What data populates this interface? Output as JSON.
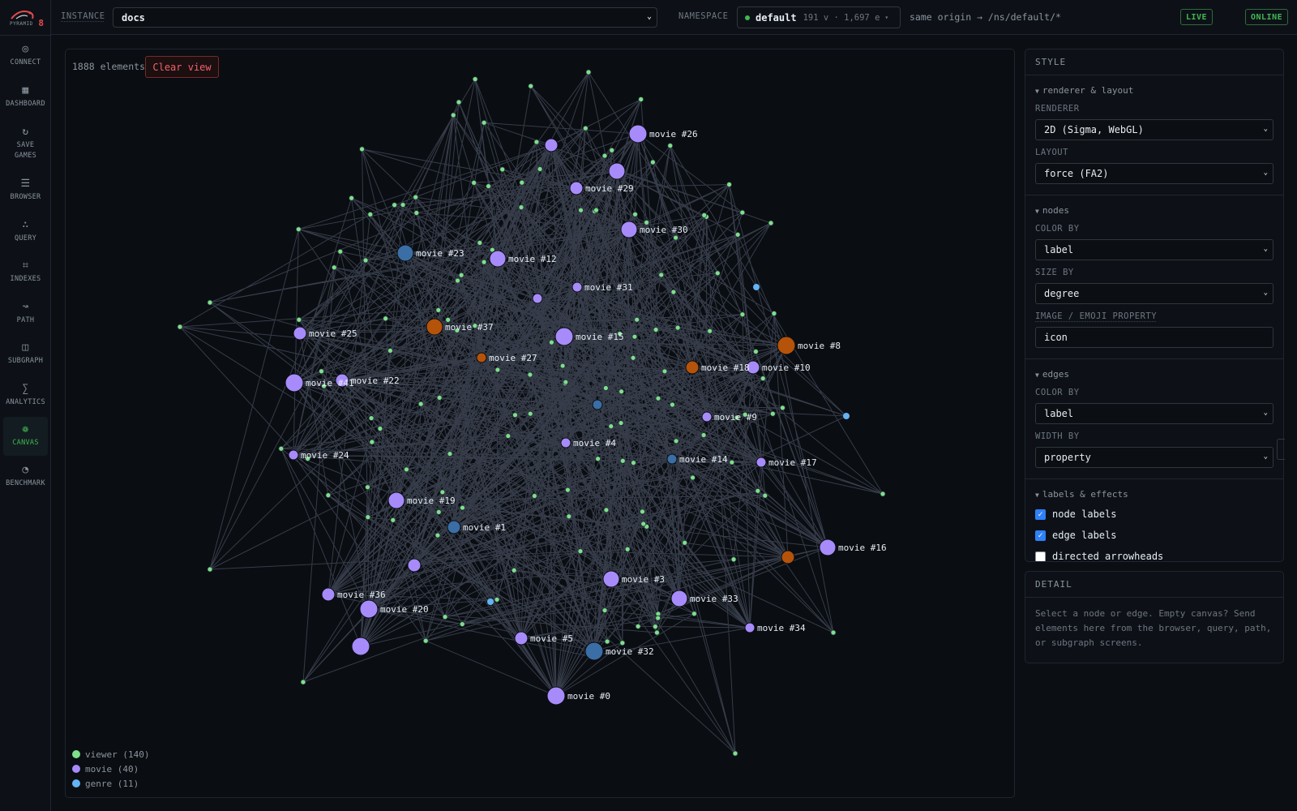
{
  "app": {
    "logo_text": "PYRAMID",
    "logo_mark": "8"
  },
  "sidebar": {
    "items": [
      {
        "label": "CONNECT",
        "icon": "target-icon"
      },
      {
        "label": "DASHBOARD",
        "icon": "grid-icon"
      },
      {
        "label": "SAVE GAMES",
        "icon": "refresh-icon"
      },
      {
        "label": "BROWSER",
        "icon": "list-icon"
      },
      {
        "label": "QUERY",
        "icon": "dots-icon"
      },
      {
        "label": "INDEXES",
        "icon": "frame-icon"
      },
      {
        "label": "PATH",
        "icon": "path-icon"
      },
      {
        "label": "SUBGRAPH",
        "icon": "subgraph-icon"
      },
      {
        "label": "ANALYTICS",
        "icon": "sigma-icon"
      },
      {
        "label": "CANVAS",
        "icon": "canvas-icon",
        "active": true
      },
      {
        "label": "BENCHMARK",
        "icon": "gauge-icon"
      }
    ]
  },
  "topbar": {
    "instance_label": "INSTANCE",
    "instance_value": "docs",
    "namespace_label": "NAMESPACE",
    "namespace_name": "default",
    "namespace_stats": "191 v · 1,697 e",
    "origin": "same origin → /ns/default/*",
    "live_badge": "LIVE",
    "online_badge": "ONLINE"
  },
  "canvas": {
    "element_count": "1888 elements",
    "clear_label": "Clear view",
    "legend": [
      {
        "label": "viewer (140)",
        "color": "#7ee08a"
      },
      {
        "label": "movie (40)",
        "color": "#a78bfa"
      },
      {
        "label": "genre (11)",
        "color": "#63b3f5"
      }
    ],
    "movie_labels": [
      "movie #0",
      "movie #1",
      "movie #3",
      "movie #4",
      "movie #5",
      "movie #8",
      "movie #9",
      "movie #10",
      "movie #12",
      "movie #14",
      "movie #15",
      "movie #16",
      "movie #17",
      "movie #18",
      "movie #19",
      "movie #20",
      "movie #22",
      "movie #23",
      "movie #24",
      "movie #25",
      "movie #26",
      "movie #27",
      "movie #29",
      "movie #30",
      "movie #31",
      "movie #32",
      "movie #33",
      "movie #34",
      "movie #36",
      "movie #37",
      "movie #41"
    ]
  },
  "style": {
    "title": "STYLE",
    "renderer_section": "renderer & layout",
    "renderer_label": "RENDERER",
    "renderer_value": "2D (Sigma, WebGL)",
    "layout_label": "LAYOUT",
    "layout_value": "force (FA2)",
    "nodes_section": "nodes",
    "node_color_label": "COLOR BY",
    "node_color_value": "label",
    "size_label": "SIZE BY",
    "size_value": "degree",
    "image_label": "IMAGE / EMOJI PROPERTY",
    "image_value": "icon",
    "edges_section": "edges",
    "edge_color_label": "COLOR BY",
    "edge_color_value": "label",
    "width_label": "WIDTH BY",
    "width_value": "property",
    "effects_section": "labels & effects",
    "node_labels": "node labels",
    "edge_labels": "edge labels",
    "arrowheads": "directed arrowheads",
    "node_labels_checked": true,
    "edge_labels_checked": true,
    "arrowheads_checked": false
  },
  "detail": {
    "title": "DETAIL",
    "text": "Select a node or edge. Empty canvas? Send elements here from the browser, query, path, or subgraph screens."
  }
}
